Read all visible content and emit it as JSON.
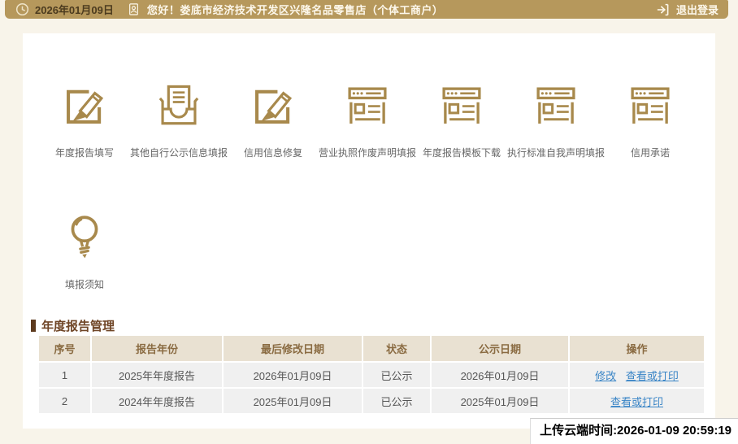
{
  "topbar": {
    "date": "2026年01月09日",
    "greeting": "您好！娄底市经济技术开发区兴隆名品零售店（个体工商户）",
    "logout_label": "退出登录"
  },
  "menu": {
    "items": [
      {
        "label": "年度报告填写",
        "icon": "edit-pencil-icon"
      },
      {
        "label": "其他自行公示信息填报",
        "icon": "inbox-document-icon"
      },
      {
        "label": "信用信息修复",
        "icon": "edit-pencil-icon"
      },
      {
        "label": "营业执照作废声明填报",
        "icon": "form-page-icon"
      },
      {
        "label": "年度报告模板下载",
        "icon": "form-page-icon"
      },
      {
        "label": "执行标准自我声明填报",
        "icon": "form-page-icon"
      },
      {
        "label": "信用承诺",
        "icon": "form-page-icon"
      }
    ],
    "notice": {
      "label": "填报须知",
      "icon": "lightbulb-icon"
    }
  },
  "annual_report_section": {
    "title": "年度报告管理",
    "table": {
      "headers": [
        "序号",
        "报告年份",
        "最后修改日期",
        "状态",
        "公示日期",
        "操作"
      ],
      "rows": [
        {
          "seq": "1",
          "report_year": "2025年年度报告",
          "last_modified": "2026年01月09日",
          "status": "已公示",
          "publish_date": "2026年01月09日",
          "actions": [
            "修改",
            "查看或打印"
          ]
        },
        {
          "seq": "2",
          "report_year": "2024年年度报告",
          "last_modified": "2025年01月09日",
          "status": "已公示",
          "publish_date": "2025年01月09日",
          "actions": [
            "查看或打印"
          ]
        }
      ]
    }
  },
  "footer": {
    "upload_time": "上传云端时间:2026-01-09 20:59:19"
  },
  "colors": {
    "topbar_bg": "#b6985c",
    "icon_gold": "#a8894c",
    "link_blue": "#3a85c6",
    "table_header_bg": "#e9e1d2",
    "title_brown": "#6f4526",
    "page_bg": "#f8f4ea"
  }
}
